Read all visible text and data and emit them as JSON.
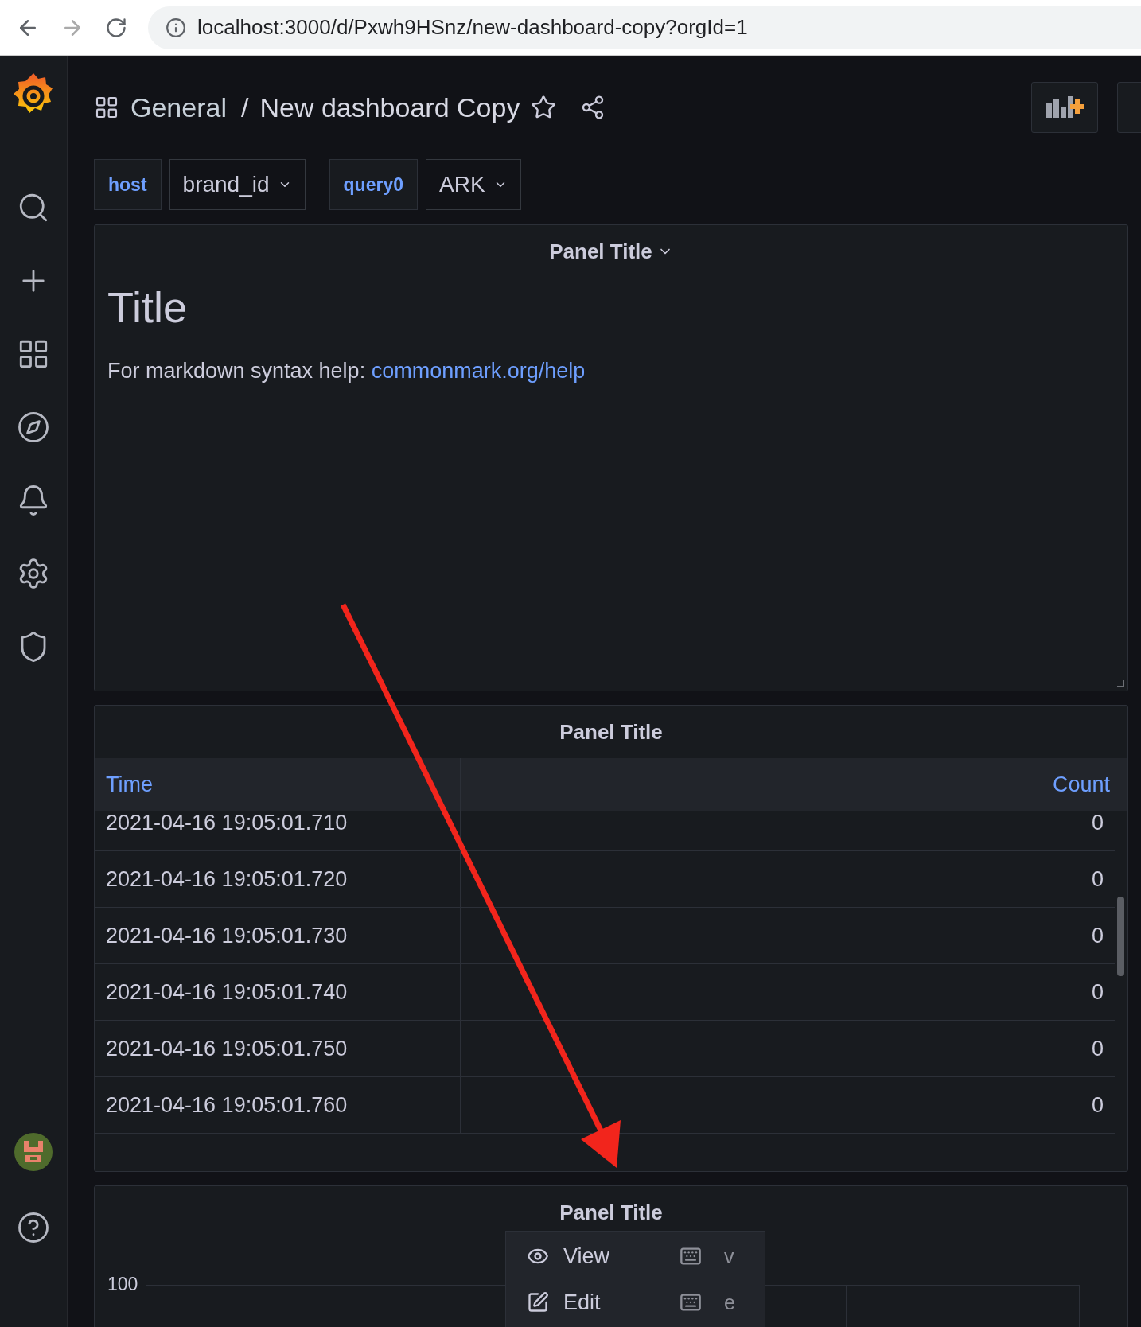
{
  "browser": {
    "url": "localhost:3000/d/Pxwh9HSnz/new-dashboard-copy?orgId=1"
  },
  "header": {
    "folder": "General",
    "separator": "/",
    "title": "New dashboard Copy"
  },
  "variables": [
    {
      "label": "host",
      "value": "brand_id"
    },
    {
      "label": "query0",
      "value": "ARK"
    }
  ],
  "text_panel": {
    "title": "Panel Title",
    "heading": "Title",
    "text": "For markdown syntax help: ",
    "link": "commonmark.org/help"
  },
  "table_panel": {
    "title": "Panel Title",
    "columns": [
      "Time",
      "Count"
    ],
    "rows": [
      [
        "2021-04-16 19:05:01.710",
        "0"
      ],
      [
        "2021-04-16 19:05:01.720",
        "0"
      ],
      [
        "2021-04-16 19:05:01.730",
        "0"
      ],
      [
        "2021-04-16 19:05:01.740",
        "0"
      ],
      [
        "2021-04-16 19:05:01.750",
        "0"
      ],
      [
        "2021-04-16 19:05:01.760",
        "0"
      ]
    ]
  },
  "graph_panel": {
    "title": "Panel Title",
    "y_tick": "100"
  },
  "panel_menu": {
    "items": [
      {
        "kind": "view",
        "label": "View",
        "shortcut": "v"
      },
      {
        "kind": "edit",
        "label": "Edit",
        "shortcut": "e"
      }
    ]
  }
}
